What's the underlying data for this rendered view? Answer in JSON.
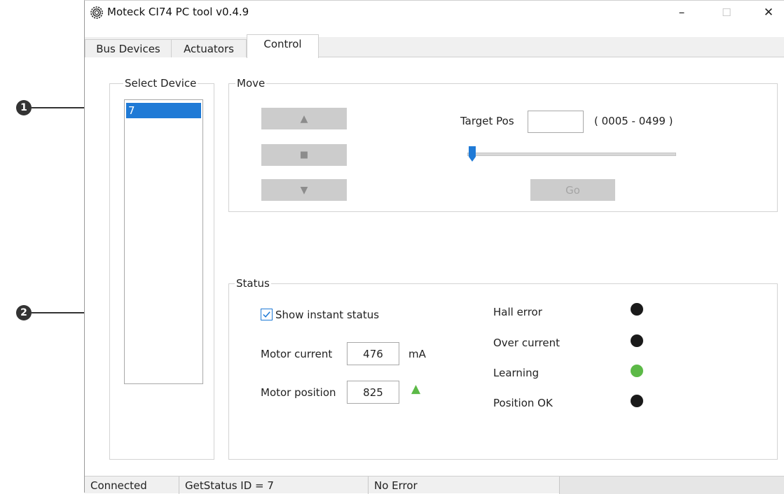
{
  "window": {
    "title": "Moteck CI74 PC tool v0.4.9",
    "controls": {
      "minimize": "–",
      "maximize": "☐",
      "close": "✕"
    }
  },
  "tabs": [
    {
      "label": "Bus Devices",
      "active": false
    },
    {
      "label": "Actuators",
      "active": false
    },
    {
      "label": "Control",
      "active": true
    }
  ],
  "select_device": {
    "label": "Select Device",
    "items": [
      "7"
    ],
    "selected": "7"
  },
  "move": {
    "label": "Move",
    "up_icon": "▲",
    "stop_icon": "■",
    "down_icon": "▼",
    "target_pos_label": "Target Pos",
    "target_pos_value": "",
    "range_text": "( 0005 - 0499 )",
    "slider_value_fraction": 0.0,
    "go_label": "Go"
  },
  "status": {
    "label": "Status",
    "show_instant_label": "Show instant status",
    "show_instant_checked": true,
    "motor_current_label": "Motor current",
    "motor_current_value": "476",
    "motor_current_unit": "mA",
    "motor_position_label": "Motor position",
    "motor_position_value": "825",
    "motor_direction_icon": "▲",
    "indicators": [
      {
        "label": "Hall error",
        "color": "#1a1a1a"
      },
      {
        "label": "Over current",
        "color": "#1a1a1a"
      },
      {
        "label": "Learning",
        "color": "#5cb947"
      },
      {
        "label": "Position OK",
        "color": "#1a1a1a"
      }
    ]
  },
  "statusbar": {
    "connection": "Connected",
    "command": "GetStatus ID = 7",
    "error": "No Error"
  },
  "callouts": [
    "1",
    "2"
  ],
  "colors": {
    "selection": "#1f7ad6",
    "indicator_active": "#5cb947",
    "indicator_off": "#1a1a1a",
    "slider_thumb": "#1f7ad6"
  }
}
